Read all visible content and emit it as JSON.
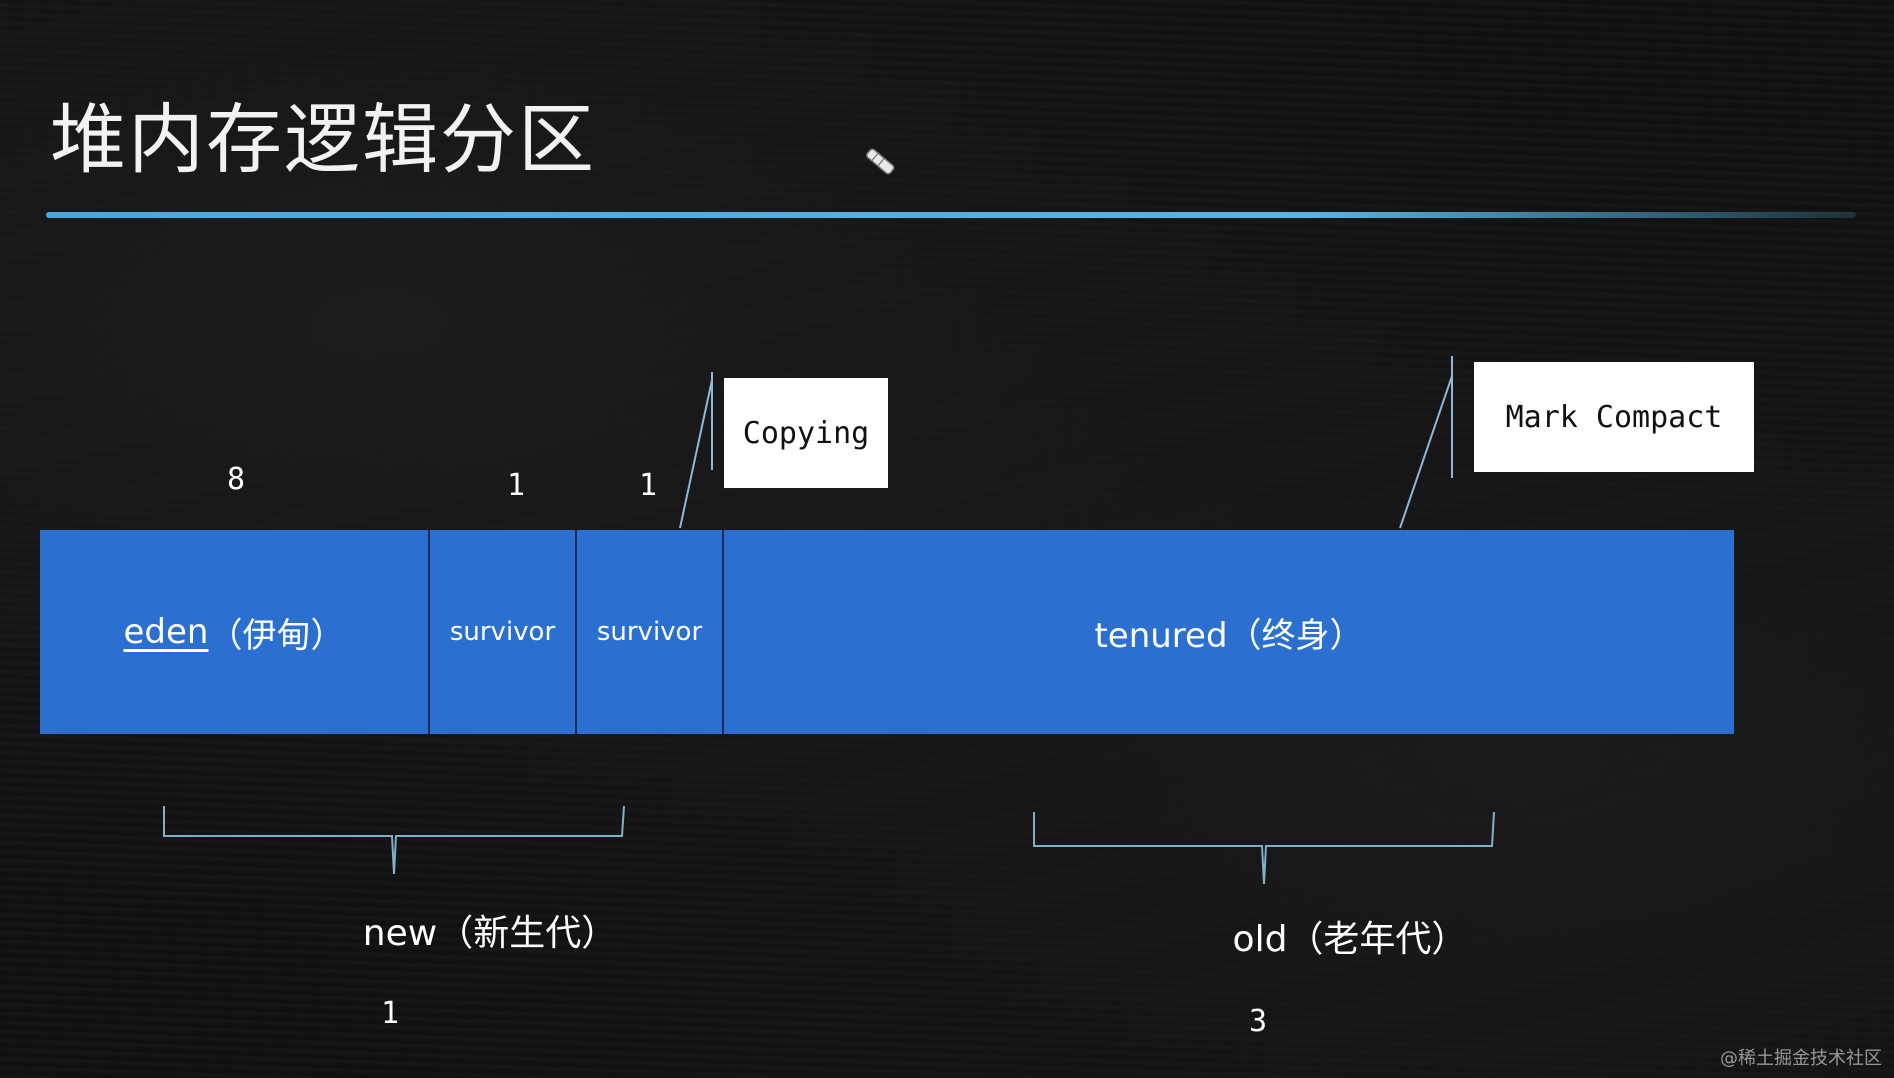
{
  "slide": {
    "title": "堆内存逻辑分区"
  },
  "colors": {
    "region_fill": "#2b6fd0",
    "region_divider": "#17295c",
    "title_rule": "#4aa8d8",
    "bracket": "#7fb0c8",
    "pointer_line": "#8fb7d6"
  },
  "regions": {
    "eden": {
      "name": "eden",
      "cn": "（伊甸）",
      "ratio": "8"
    },
    "survivor_1": {
      "label": "survivor",
      "ratio": "1"
    },
    "survivor_2": {
      "label": "survivor",
      "ratio": "1"
    },
    "tenured": {
      "label": "tenured（终身）"
    }
  },
  "callouts": {
    "copying": "Copying",
    "mark_compact": "Mark Compact"
  },
  "groups": {
    "new": {
      "label": "new（新生代）",
      "ratio": "1"
    },
    "old": {
      "label": "old（老年代）",
      "ratio": "3"
    }
  },
  "watermark": "@稀土掘金技术社区",
  "cursor_icon": "pen-cursor-icon"
}
